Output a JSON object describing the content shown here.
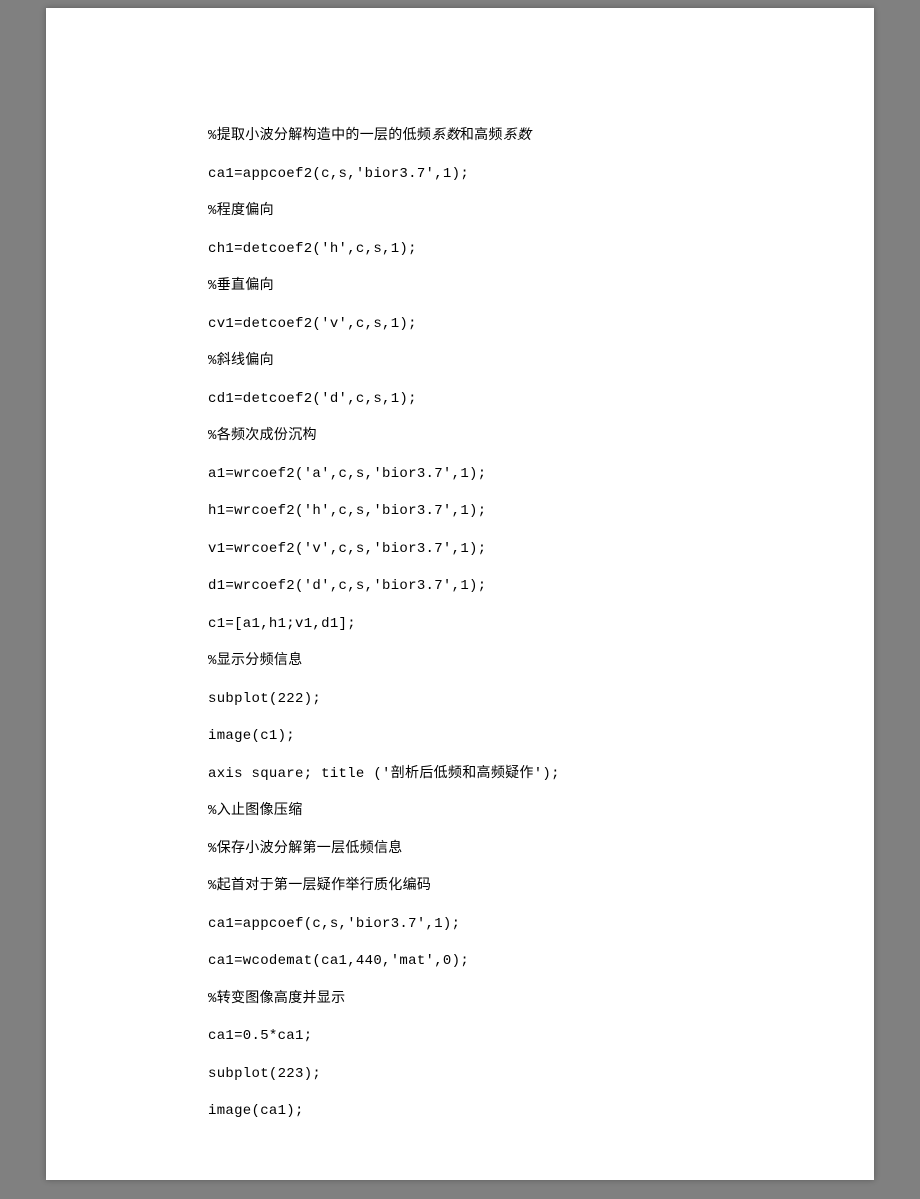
{
  "lines": [
    {
      "segments": [
        {
          "text": "%提取小波分解构造中的一层的低频"
        },
        {
          "text": "系数",
          "italic": true
        },
        {
          "text": "和高频"
        },
        {
          "text": "系数",
          "italic": true
        }
      ]
    },
    {
      "segments": [
        {
          "text": "ca1=appcoef2(c,s,'bior3.7',1);"
        }
      ]
    },
    {
      "segments": [
        {
          "text": "%程度偏向"
        }
      ]
    },
    {
      "segments": [
        {
          "text": "ch1=detcoef2('h',c,s,1);"
        }
      ]
    },
    {
      "segments": [
        {
          "text": "%垂直偏向"
        }
      ]
    },
    {
      "segments": [
        {
          "text": "cv1=detcoef2('v',c,s,1);"
        }
      ]
    },
    {
      "segments": [
        {
          "text": "%斜线偏向"
        }
      ]
    },
    {
      "segments": [
        {
          "text": "cd1=detcoef2('d',c,s,1);"
        }
      ]
    },
    {
      "segments": [
        {
          "text": "%各频次成份沉构"
        }
      ]
    },
    {
      "segments": [
        {
          "text": "a1=wrcoef2('a',c,s,'bior3.7',1);"
        }
      ]
    },
    {
      "segments": [
        {
          "text": "h1=wrcoef2('h',c,s,'bior3.7',1);"
        }
      ]
    },
    {
      "segments": [
        {
          "text": "v1=wrcoef2('v',c,s,'bior3.7',1);"
        }
      ]
    },
    {
      "segments": [
        {
          "text": "d1=wrcoef2('d',c,s,'bior3.7',1);"
        }
      ]
    },
    {
      "segments": [
        {
          "text": "c1=[a1,h1;v1,d1];"
        }
      ]
    },
    {
      "segments": [
        {
          "text": "%显示分频信息"
        }
      ]
    },
    {
      "segments": [
        {
          "text": "subplot(222);"
        }
      ]
    },
    {
      "segments": [
        {
          "text": "image(c1);"
        }
      ]
    },
    {
      "segments": [
        {
          "text": "axis square; title ('剖析后低频和高频疑作');"
        }
      ]
    },
    {
      "segments": [
        {
          "text": "%入止图像压缩"
        }
      ]
    },
    {
      "segments": [
        {
          "text": "%保存小波分解第一层低频信息"
        }
      ]
    },
    {
      "segments": [
        {
          "text": "%起首对于第一层疑作举行质化编码"
        }
      ]
    },
    {
      "segments": [
        {
          "text": "ca1=appcoef(c,s,'bior3.7',1);"
        }
      ]
    },
    {
      "segments": [
        {
          "text": "ca1=wcodemat(ca1,440,'mat',0);"
        }
      ]
    },
    {
      "segments": [
        {
          "text": "%转变图像高度并显示"
        }
      ]
    },
    {
      "segments": [
        {
          "text": "ca1=0.5*ca1;"
        }
      ]
    },
    {
      "segments": [
        {
          "text": "subplot(223);"
        }
      ]
    },
    {
      "segments": [
        {
          "text": "image(ca1);"
        }
      ]
    }
  ]
}
